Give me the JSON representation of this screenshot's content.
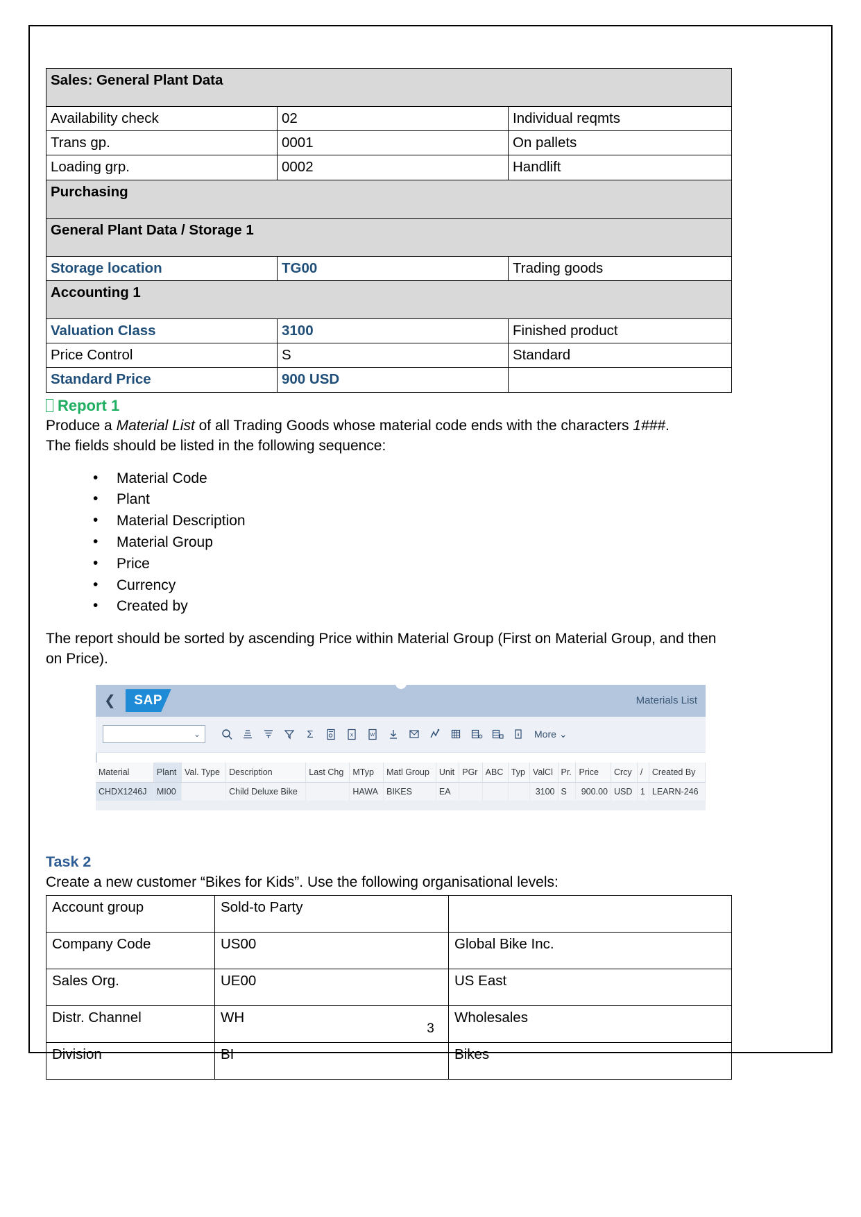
{
  "document": {
    "page_number": "3"
  },
  "material_table": {
    "sections": [
      {
        "kind": "section",
        "label": "Sales: General Plant Data"
      },
      {
        "kind": "row",
        "label": "Availability check",
        "value": "02",
        "desc": "Individual reqmts",
        "highlight": false
      },
      {
        "kind": "row",
        "label": "Trans gp.",
        "value": "0001",
        "desc": "On pallets",
        "highlight": false
      },
      {
        "kind": "row",
        "label": "Loading grp.",
        "value": "0002",
        "desc": "Handlift",
        "highlight": false
      },
      {
        "kind": "section",
        "label": "Purchasing"
      },
      {
        "kind": "section",
        "label": "General Plant Data / Storage 1"
      },
      {
        "kind": "row",
        "label": "Storage location",
        "value": "TG00",
        "desc": "Trading goods",
        "highlight": true
      },
      {
        "kind": "section",
        "label": "Accounting 1"
      },
      {
        "kind": "row",
        "label": "Valuation Class",
        "value": "3100",
        "desc": "Finished product",
        "highlight": true
      },
      {
        "kind": "row",
        "label": "Price Control",
        "value": "S",
        "desc": "Standard",
        "highlight": false
      },
      {
        "kind": "row",
        "label": "Standard Price",
        "value": "900 USD",
        "desc": "",
        "highlight": true
      }
    ]
  },
  "report": {
    "heading": "Report 1",
    "intro_part1": "Produce a ",
    "intro_italic": "Material List",
    "intro_part2": " of all Trading Goods whose material code ends with the characters ",
    "intro_italic2": "1###",
    "intro_part3": ".",
    "intro_line2": "The fields should be listed in the following sequence:",
    "fields": [
      "Material Code",
      "Plant",
      "Material Description",
      "Material Group",
      "Price",
      "Currency",
      "Created by"
    ],
    "sort_note": "The report should be sorted by ascending Price within Material Group (First on Material Group, and then on Price)."
  },
  "sap": {
    "logo": "SAP",
    "back_icon": "chevron-left-icon",
    "title": "Materials List",
    "select_value": "",
    "more_label": "More",
    "toolbar_icons": [
      "search-icon",
      "sort-icon",
      "filter-settings-icon",
      "filter-icon",
      "sum-icon",
      "print-preview-icon",
      "export-excel-icon",
      "export-word-icon",
      "download-icon",
      "mail-icon",
      "graphic-icon",
      "layout-icon",
      "layout-change-icon",
      "layout-manage-icon",
      "info-icon"
    ],
    "grid": {
      "columns": [
        "Material",
        "Plant",
        "Val. Type",
        "Description",
        "Last Chg",
        "MTyp",
        "Matl Group",
        "Unit",
        "PGr",
        "ABC",
        "Typ",
        "ValCl",
        "Pr.",
        "Price",
        "Crcy",
        "/",
        "Created By"
      ],
      "rows": [
        {
          "material": "CHDX1246J",
          "plant": "MI00",
          "val_type": "",
          "description": "Child Deluxe Bike",
          "last_chg": "",
          "mtyp": "HAWA",
          "matl_group": "BIKES",
          "unit": "EA",
          "pgr": "",
          "abc": "",
          "typ": "",
          "valcl": "3100",
          "pr": "S",
          "price": "900.00",
          "crcy": "USD",
          "slash": "1",
          "created_by": "LEARN-246"
        }
      ]
    }
  },
  "task2": {
    "heading": "Task 2",
    "intro": "Create a new customer “Bikes for Kids”. Use the following organisational levels:",
    "rows": [
      {
        "label": "Account group",
        "value": "Sold-to Party",
        "desc": ""
      },
      {
        "label": "Company Code",
        "value": "US00",
        "desc": "Global Bike Inc."
      },
      {
        "label": "Sales Org.",
        "value": "UE00",
        "desc": "US East"
      },
      {
        "label": "Distr. Channel",
        "value": "WH",
        "desc": "Wholesales"
      },
      {
        "label": "Division",
        "value": "BI",
        "desc": "Bikes"
      }
    ]
  },
  "colors": {
    "shade": "#d9d9d9",
    "blue_label": "#1f4e79",
    "green_heading": "#1fae61",
    "task_heading": "#2e5c94",
    "sap_bar": "#b3c6dd",
    "sap_logo": "#1f8ad6"
  }
}
